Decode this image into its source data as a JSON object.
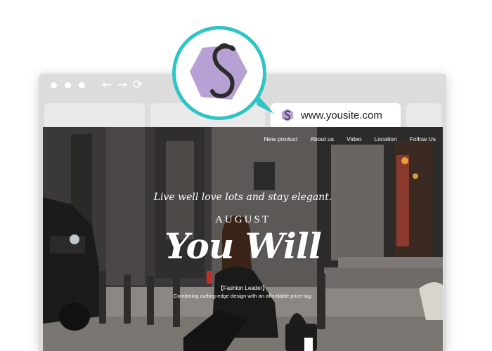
{
  "browser": {
    "url": "www.yousite.com",
    "nav_icons": [
      "back-arrow-icon",
      "forward-arrow-icon",
      "refresh-icon"
    ]
  },
  "site": {
    "nav": [
      "New product",
      "About us",
      "Video",
      "Location",
      "Follow Us"
    ],
    "tagline": "Live well love lots and stay elegant.",
    "month": "AUGUST",
    "script_title": "You Will",
    "leader": "【Fashion Leader】",
    "description": "Combining cutting-edge design with an affordable price tag."
  },
  "colors": {
    "accent": "#2cc4c4",
    "logo": "#b7a0d4",
    "frame": "#dcdcdc"
  }
}
